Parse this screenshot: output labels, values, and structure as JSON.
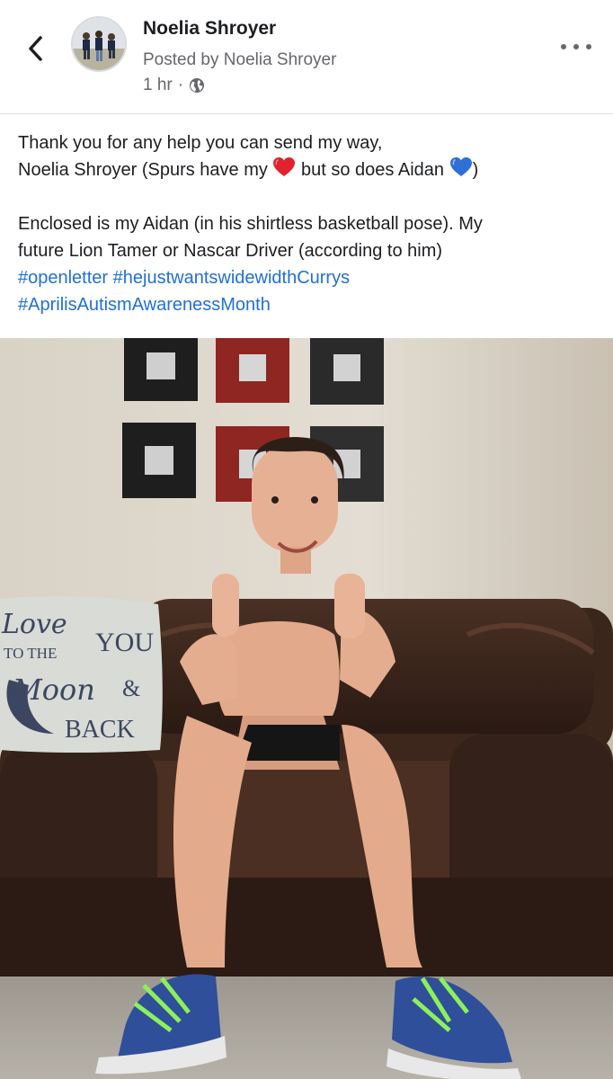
{
  "header": {
    "back_icon": "chevron-left-icon",
    "author_name": "Noelia Shroyer",
    "posted_by": "Posted by Noelia Shroyer",
    "time": "1 hr",
    "separator": "·",
    "privacy_icon": "globe-icon",
    "more_icon": "more-horizontal-icon"
  },
  "post": {
    "line1": "Thank you for any help you can send my way,",
    "line2_a": "Noelia Shroyer (Spurs have my ",
    "line2_b": " but so does Aidan ",
    "line2_c": ")",
    "heart_red_icon": "red-heart-icon",
    "heart_blue_icon": "blue-heart-icon",
    "line3": "Enclosed is my Aidan (in his shirtless basketball pose). My",
    "line4": "future Lion Tamer or Nascar Driver (according to him)",
    "hashtag1": "#openletter",
    "hashtag2": "#hejustwantswidewidthCurrys",
    "hashtag3": "#AprilisAutismAwarenessMonth"
  },
  "photo": {
    "pillow_text": [
      "Love",
      "YOU",
      "TO THE",
      "Moon",
      "&",
      "BACK"
    ]
  },
  "colors": {
    "hashtag": "#216fdb",
    "secondary_text": "#65676b",
    "heart_red": "#e0232e",
    "heart_blue": "#2f6fd6"
  }
}
